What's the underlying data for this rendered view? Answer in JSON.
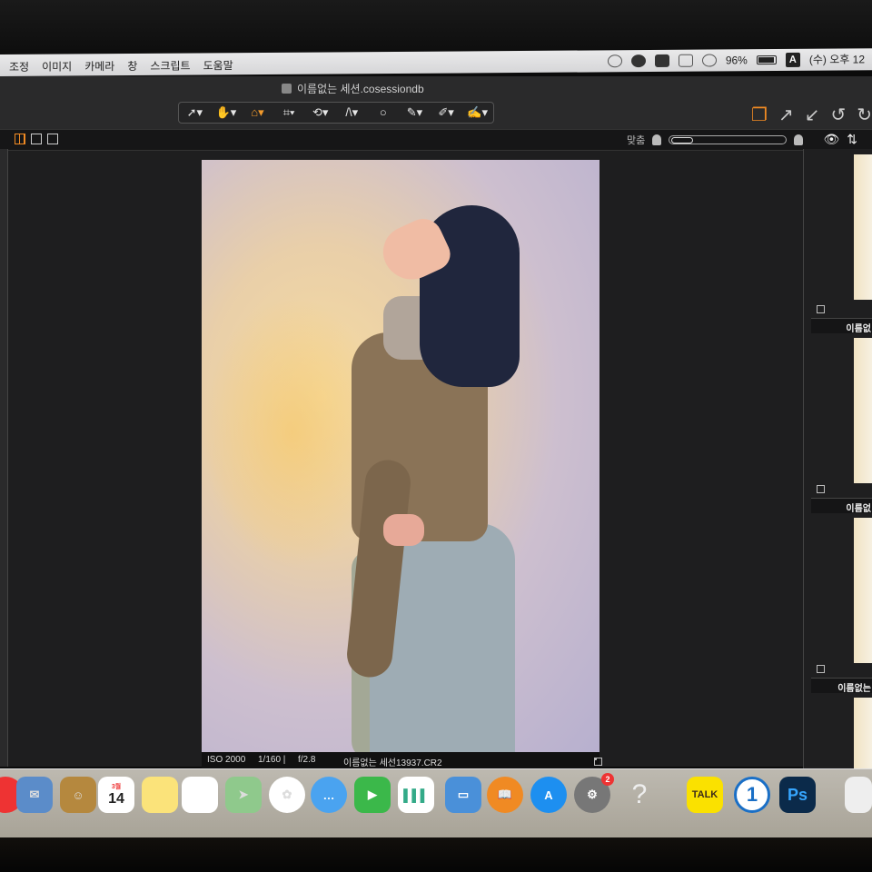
{
  "menubar": {
    "menus": [
      "조정",
      "이미지",
      "카메라",
      "창",
      "스크립트",
      "도움말"
    ],
    "battery_percent": "96%",
    "input_source": "A",
    "clock": "(수) 오후 12"
  },
  "window": {
    "title": "이름없는 세션.cosessiondb"
  },
  "viewer": {
    "zoom_label": "맞춤"
  },
  "photo_info": {
    "iso": "ISO 2000",
    "shutter": "1/160 |",
    "aperture": "f/2.8",
    "filename": "이름없는 세선13937.CR2"
  },
  "filmstrip": {
    "items": [
      {
        "label": "이름없"
      },
      {
        "label": "이름없"
      },
      {
        "label": "이름없는"
      }
    ]
  },
  "dock": {
    "calendar_day": "14",
    "calendar_month": "3월",
    "appstore_badge": "2",
    "kakao_label": "TALK",
    "onepassword_label": "1",
    "photoshop_label": "Ps",
    "help_label": "?"
  },
  "colors": {
    "accent": "#f08a23",
    "window_bg": "#1e1e1f"
  }
}
